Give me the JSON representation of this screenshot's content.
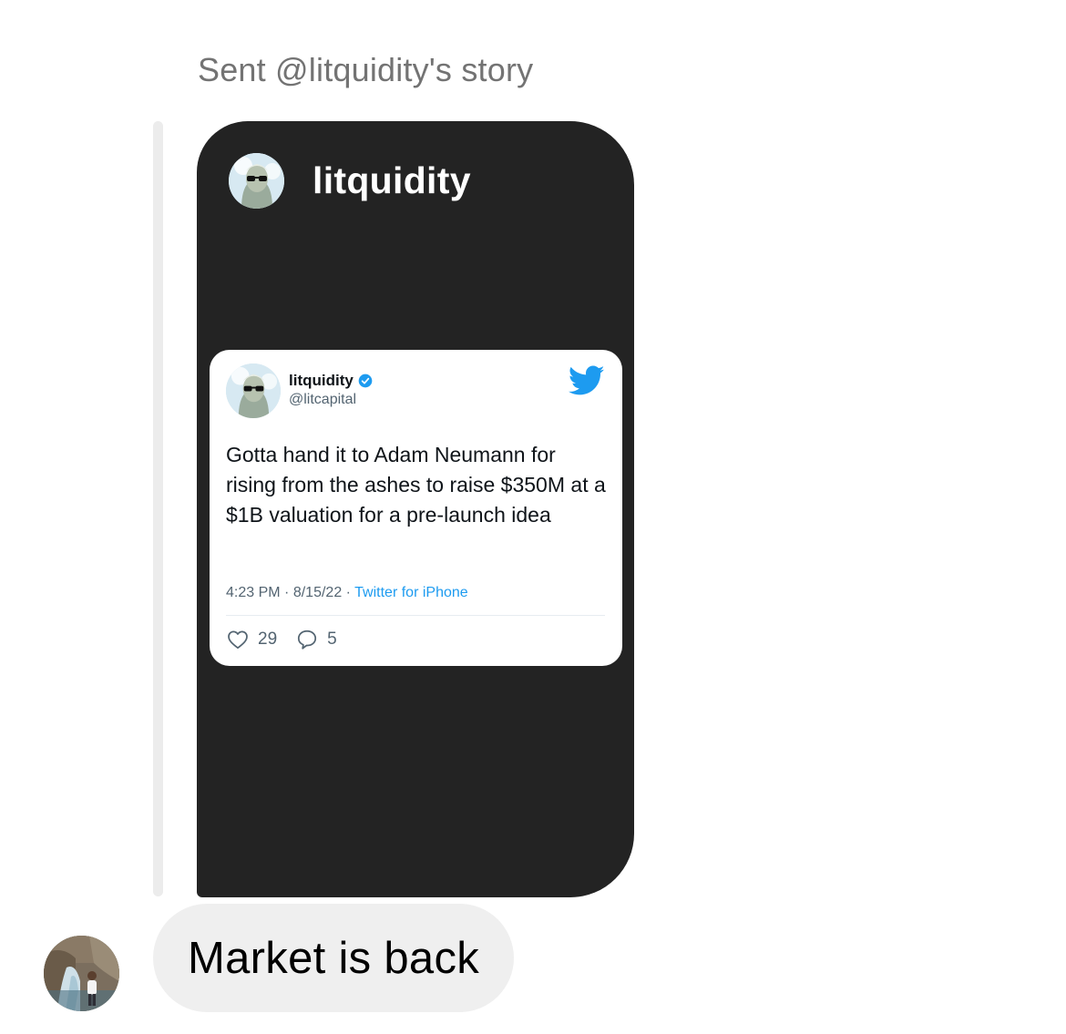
{
  "thread": {
    "sent_label": "Sent @litquidity's story"
  },
  "story": {
    "username": "litquidity",
    "background_color": "#232323"
  },
  "tweet": {
    "display_name": "litquidity",
    "verified": true,
    "handle": "@litcapital",
    "text": "Gotta hand it to Adam Neumann for rising from the ashes to raise $350M at a $1B valuation for a pre-launch idea",
    "time": "4:23 PM",
    "date": "8/15/22",
    "source": "Twitter for iPhone",
    "likes": "29",
    "replies": "5",
    "brand_color": "#1d9bf0"
  },
  "message": {
    "text": "Market is back"
  },
  "icons": {
    "story_avatar": "avatar-icon",
    "tweet_avatar": "avatar-icon",
    "verified": "verified-badge-icon",
    "twitter": "twitter-bird-icon",
    "like": "heart-icon",
    "reply": "speech-bubble-icon",
    "sender_avatar": "avatar-icon"
  }
}
